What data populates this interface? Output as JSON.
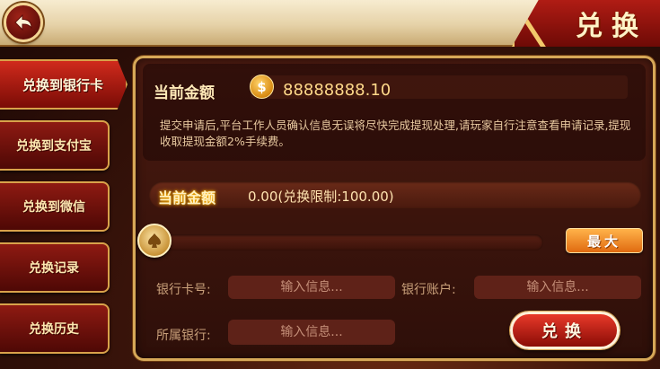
{
  "header": {
    "title": "兑换",
    "back_icon": "back-arrow-icon"
  },
  "menu": {
    "items": [
      {
        "label": "兑换到银行卡",
        "active": true
      },
      {
        "label": "兑换到支付宝",
        "active": false
      },
      {
        "label": "兑换到微信",
        "active": false
      },
      {
        "label": "兑换记录",
        "active": false
      },
      {
        "label": "兑换历史",
        "active": false
      }
    ]
  },
  "balance": {
    "label": "当前金额",
    "value": "88888888.10",
    "icon": "coin-icon"
  },
  "notice": "提交申请后,平台工作人员确认信息无误将尽快完成提现处理,请玩家自行注意查看申请记录,提现收取提现金额2%手续费。",
  "withdraw": {
    "label": "当前金额",
    "amount": "0.00(兑换限制:100.00)",
    "slider_value": 0,
    "max_label": "最大"
  },
  "form": {
    "card_label": "银行卡号:",
    "card_placeholder": "输入信息...",
    "account_label": "银行账户:",
    "account_placeholder": "输入信息...",
    "bank_label": "所属银行:",
    "bank_placeholder": "输入信息...",
    "submit_label": "兑换"
  },
  "colors": {
    "accent": "#d6a858",
    "brand_red": "#b01c14",
    "max_button": "#f08a20"
  }
}
